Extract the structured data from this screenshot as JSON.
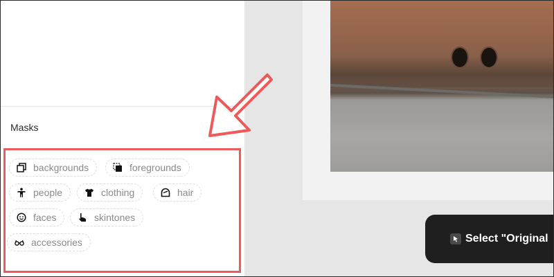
{
  "masks_panel": {
    "heading": "Masks",
    "chips": [
      {
        "label": "backgrounds",
        "icon": "backgrounds-icon"
      },
      {
        "label": "foregrounds",
        "icon": "foregrounds-icon"
      },
      {
        "label": "people",
        "icon": "person-icon"
      },
      {
        "label": "clothing",
        "icon": "shirt-icon"
      },
      {
        "label": "hair",
        "icon": "hair-icon"
      },
      {
        "label": "faces",
        "icon": "face-icon"
      },
      {
        "label": "skintones",
        "icon": "hand-pointer-icon"
      },
      {
        "label": "accessories",
        "icon": "glasses-icon"
      }
    ]
  },
  "toast": {
    "text": "Select \"Original",
    "icon": "cursor-icon"
  },
  "colors": {
    "highlight": "#ee5a5a",
    "toast_bg": "#1f1f1f"
  }
}
